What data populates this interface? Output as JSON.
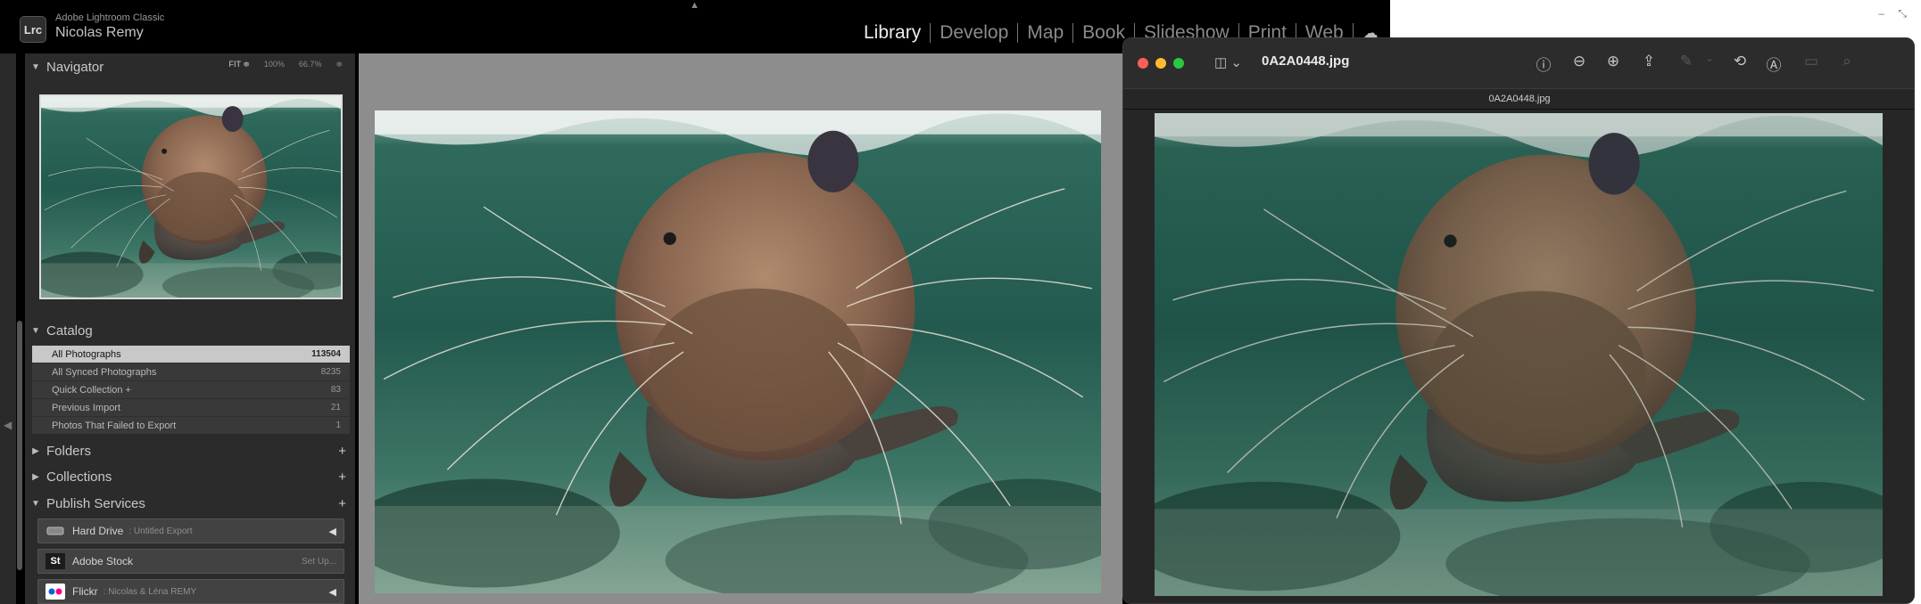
{
  "lightroom": {
    "app_name": "Adobe Lightroom Classic",
    "logo_text": "Lrc",
    "user_name": "Nicolas Remy",
    "modules": [
      "Library",
      "Develop",
      "Map",
      "Book",
      "Slideshow",
      "Print",
      "Web"
    ],
    "active_module": "Library",
    "navigator": {
      "title": "Navigator",
      "zoom_fit": "FIT ≑",
      "zoom_100": "100%",
      "zoom_667": "66.7%",
      "zoom_more": "≑"
    },
    "catalog": {
      "title": "Catalog",
      "items": [
        {
          "label": "All Photographs",
          "count": "113504",
          "selected": true
        },
        {
          "label": "All Synced Photographs",
          "count": "8235"
        },
        {
          "label": "Quick Collection +",
          "count": "83"
        },
        {
          "label": "Previous Import",
          "count": "21"
        },
        {
          "label": "Photos That Failed to Export",
          "count": "1"
        }
      ]
    },
    "folders": {
      "title": "Folders",
      "plus": "+"
    },
    "collections": {
      "title": "Collections",
      "plus": "+"
    },
    "publish_services": {
      "title": "Publish Services",
      "plus": "+",
      "services": [
        {
          "name": "Hard Drive",
          "sub": ": Untitled Export",
          "right": "◀",
          "icon": "hard-drive-icon"
        },
        {
          "name": "Adobe Stock",
          "sub": "",
          "right": "Set Up...",
          "icon_text": "St"
        },
        {
          "name": "Flickr",
          "sub": ": Nicolas & Léna REMY",
          "right": "◀",
          "icon": "flickr-icon"
        }
      ]
    }
  },
  "preview": {
    "title": "0A2A0448.jpg",
    "tab": "0A2A0448.jpg",
    "colors": {
      "close": "#ff5f57",
      "minimize": "#febc2e",
      "zoom": "#28c840"
    }
  }
}
